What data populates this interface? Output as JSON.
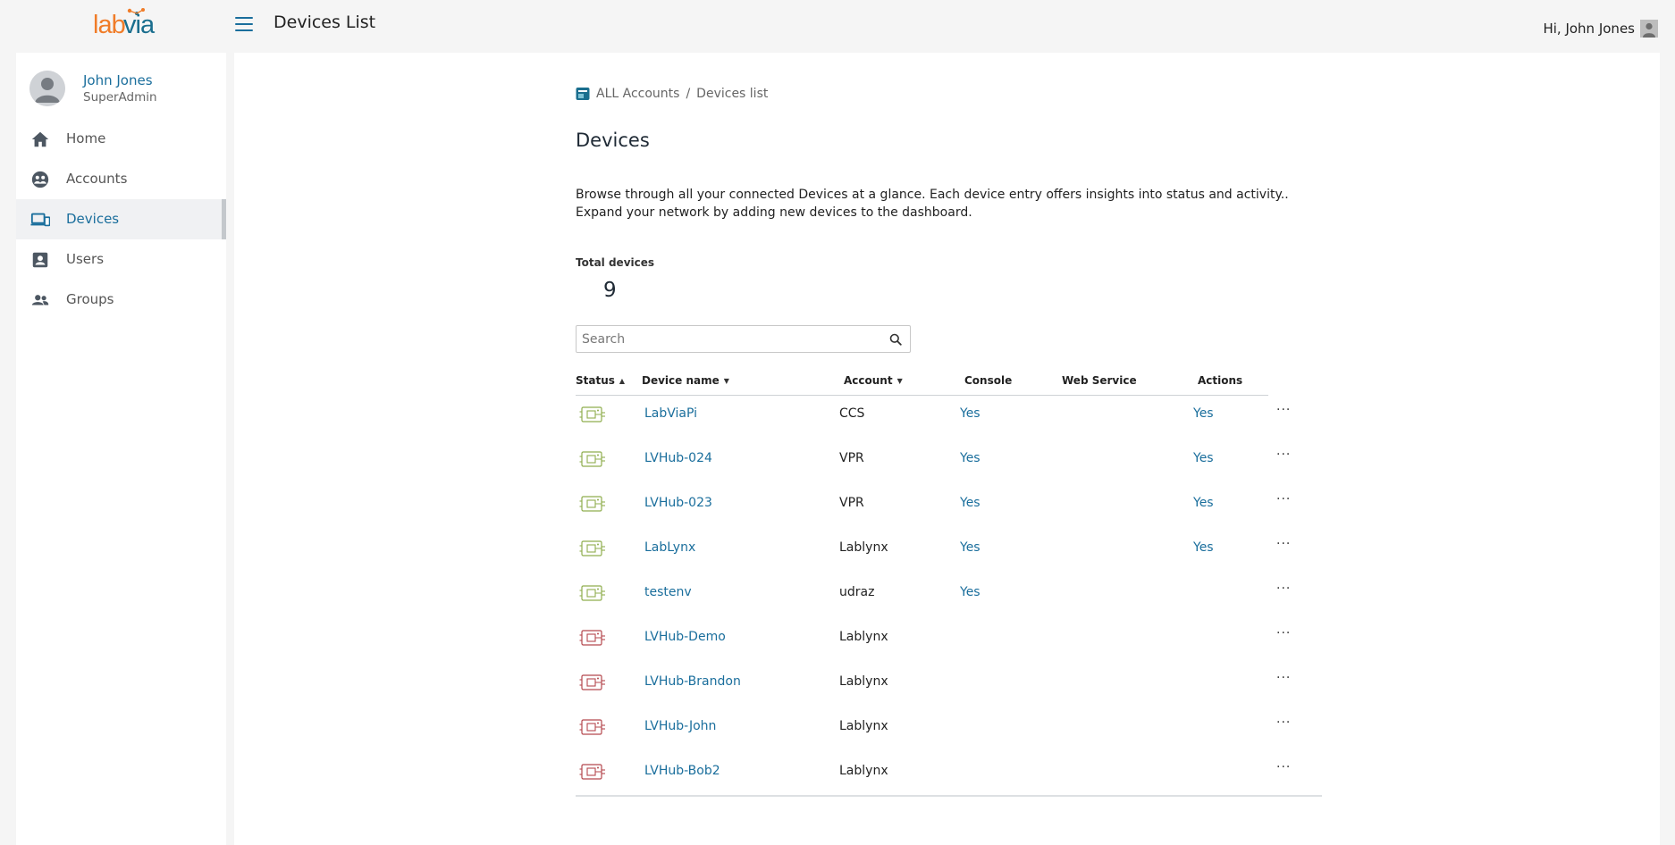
{
  "topbar": {
    "logo_lab": "lab",
    "logo_via": "via",
    "page_title": "Devices List",
    "greeting": "Hi, John Jones"
  },
  "profile": {
    "name": "John Jones",
    "role": "SuperAdmin"
  },
  "nav": {
    "items": [
      {
        "label": "Home",
        "icon": "home-icon",
        "active": false
      },
      {
        "label": "Accounts",
        "icon": "accounts-icon",
        "active": false
      },
      {
        "label": "Devices",
        "icon": "devices-icon",
        "active": true
      },
      {
        "label": "Users",
        "icon": "user-badge-icon",
        "active": false
      },
      {
        "label": "Groups",
        "icon": "groups-icon",
        "active": false
      }
    ]
  },
  "breadcrumb": {
    "root": "ALL Accounts",
    "separator": "/",
    "current": "Devices list"
  },
  "page": {
    "title": "Devices",
    "description_line1": "Browse through all your connected Devices at a glance. Each device entry offers insights into status and activity..",
    "description_line2": "Expand your network by adding new devices to the dashboard.",
    "total_label": "Total devices",
    "total_value": "9"
  },
  "search": {
    "placeholder": "Search",
    "value": ""
  },
  "table": {
    "columns": {
      "status": "Status",
      "device_name": "Device name",
      "account": "Account",
      "console": "Console",
      "web_service": "Web Service",
      "actions": "Actions"
    },
    "sort": {
      "status": "asc",
      "device_name": "desc",
      "account": "desc"
    },
    "rows": [
      {
        "status": "online",
        "name": "LabViaPi",
        "account": "CCS",
        "console": "Yes",
        "web_service": "",
        "actions": "Yes",
        "more": "···"
      },
      {
        "status": "online",
        "name": "LVHub-024",
        "account": "VPR",
        "console": "Yes",
        "web_service": "",
        "actions": "Yes",
        "more": "···"
      },
      {
        "status": "online",
        "name": "LVHub-023",
        "account": "VPR",
        "console": "Yes",
        "web_service": "",
        "actions": "Yes",
        "more": "···"
      },
      {
        "status": "online",
        "name": "LabLynx",
        "account": "Lablynx",
        "console": "Yes",
        "web_service": "",
        "actions": "Yes",
        "more": "···"
      },
      {
        "status": "online",
        "name": "testenv",
        "account": "udraz",
        "console": "Yes",
        "web_service": "",
        "actions": "",
        "more": "···"
      },
      {
        "status": "offline",
        "name": "LVHub-Demo",
        "account": "Lablynx",
        "console": "",
        "web_service": "",
        "actions": "",
        "more": "···"
      },
      {
        "status": "offline",
        "name": "LVHub-Brandon",
        "account": "Lablynx",
        "console": "",
        "web_service": "",
        "actions": "",
        "more": "···"
      },
      {
        "status": "offline",
        "name": "LVHub-John",
        "account": "Lablynx",
        "console": "",
        "web_service": "",
        "actions": "",
        "more": "···"
      },
      {
        "status": "offline",
        "name": "LVHub-Bob2",
        "account": "Lablynx",
        "console": "",
        "web_service": "",
        "actions": "",
        "more": "···"
      }
    ]
  },
  "colors": {
    "accent": "#1a6e9c",
    "online": "#8fae4e",
    "offline": "#b5484e",
    "logo_orange": "#f07c28"
  }
}
